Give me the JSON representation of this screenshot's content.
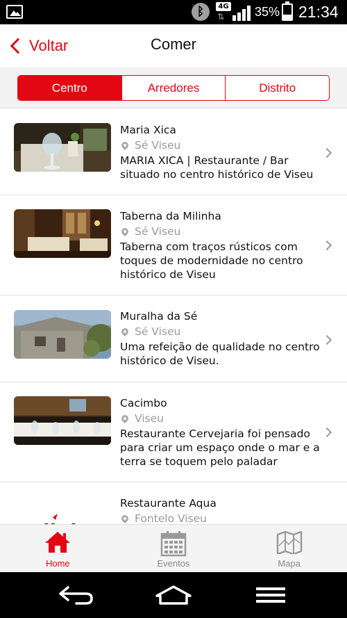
{
  "status_bar": {
    "network": "4G",
    "battery": "35%",
    "battery_level": 0.35,
    "time": "21:34"
  },
  "header": {
    "back_label": "Voltar",
    "title": "Comer"
  },
  "segments": [
    {
      "label": "Centro",
      "active": true
    },
    {
      "label": "Arredores",
      "active": false
    },
    {
      "label": "Distrito",
      "active": false
    }
  ],
  "items": [
    {
      "name": "Maria Xica",
      "location": "Sé Viseu",
      "description": "MARIA XICA | Restaurante / Bar situado no centro histórico de Viseu"
    },
    {
      "name": "Taberna da Milinha",
      "location": "Sé Viseu",
      "description": "Taberna com traços rústicos com toques de modernidade no centro histórico de Viseu"
    },
    {
      "name": "Muralha da Sé",
      "location": "Sé Viseu",
      "description": "Uma refeição de qualidade no centro histórico de Viseu."
    },
    {
      "name": "Cacimbo",
      "location": "Viseu",
      "description": "Restaurante Cervejaria foi pensado para criar um espaço onde o mar e a terra se toquem pelo paladar"
    },
    {
      "name": "Restaurante Aqua",
      "location": "Fontelo Viseu",
      "description": "",
      "logo_text": "link"
    }
  ],
  "bottom_nav": [
    {
      "label": "Home",
      "icon": "home-icon",
      "active": true
    },
    {
      "label": "Eventos",
      "icon": "calendar-icon",
      "active": false
    },
    {
      "label": "Mapa",
      "icon": "map-icon",
      "active": false
    }
  ],
  "colors": {
    "accent": "#e30613",
    "inactive": "#888888"
  }
}
